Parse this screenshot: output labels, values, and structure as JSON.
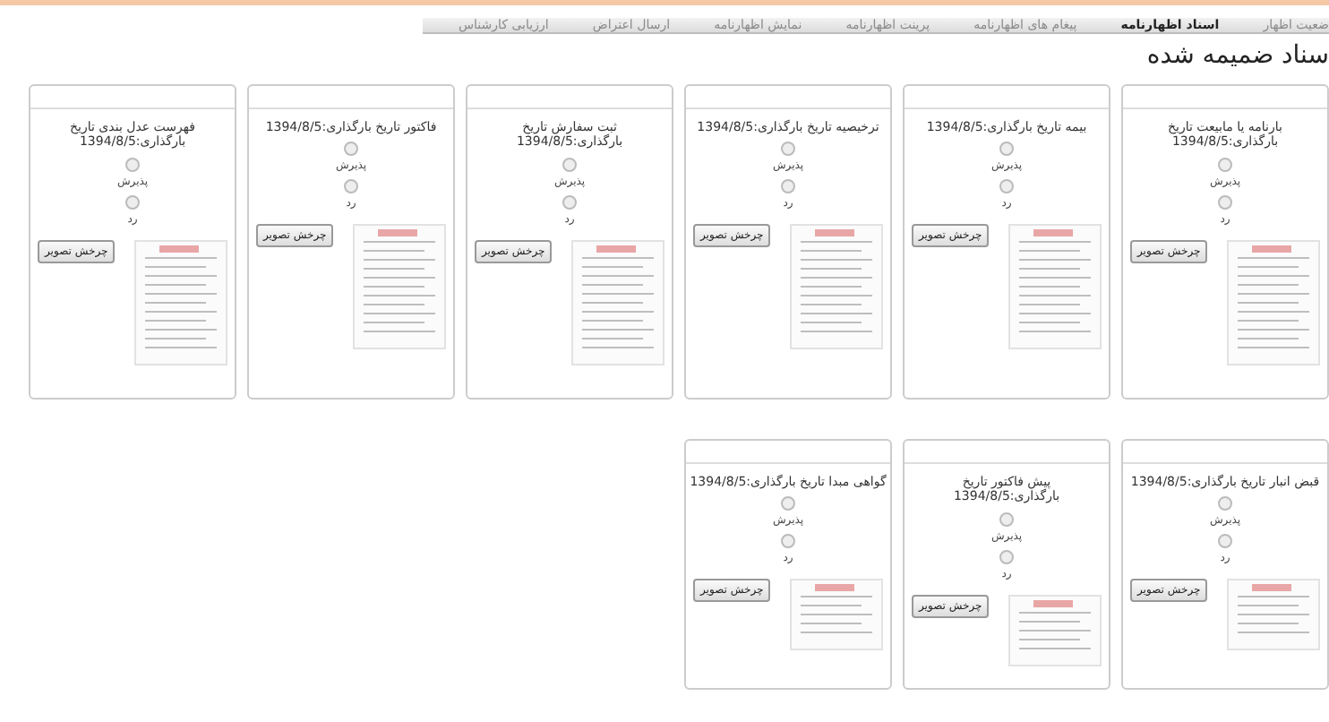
{
  "nav": {
    "tabs": [
      {
        "label": "ضعیت اظهار",
        "selected": false
      },
      {
        "label": "اسناد اظهارنامه",
        "selected": true
      },
      {
        "label": "پیغام های اظهارنامه",
        "selected": false
      },
      {
        "label": "پرینت اظهارنامه",
        "selected": false
      },
      {
        "label": "نمایش اظهارنامه",
        "selected": false
      },
      {
        "label": "ارسال اعتراض",
        "selected": false
      },
      {
        "label": "ارزیابی کارشناس",
        "selected": false
      }
    ]
  },
  "heading": "سناد ضمیمه شده",
  "rows": [
    {
      "cards": [
        {
          "title": "بارنامه یا مابیعت تاریخ بارگذاری:1394/8/5",
          "options": [
            {
              "label": "پذیرش",
              "selected": false
            },
            {
              "label": "رد",
              "selected": false
            }
          ],
          "button": "چرخش تصویر"
        },
        {
          "title": "بیمه تاریخ بارگذاری:1394/8/5",
          "options": [
            {
              "label": "پذیرش",
              "selected": false
            },
            {
              "label": "رد",
              "selected": false
            }
          ],
          "button": "چرخش تصویر"
        },
        {
          "title": "ترخیصیه تاریخ بارگذاری:1394/8/5",
          "options": [
            {
              "label": "پذیرش",
              "selected": false
            },
            {
              "label": "رد",
              "selected": false
            }
          ],
          "button": "چرخش تصویر"
        },
        {
          "title": "ثبت سفارش تاریخ بارگذاری:1394/8/5",
          "options": [
            {
              "label": "پذیرش",
              "selected": false
            },
            {
              "label": "رد",
              "selected": false
            }
          ],
          "button": "چرخش تصویر"
        },
        {
          "title": "فاکتور تاریخ بارگذاری:1394/8/5",
          "options": [
            {
              "label": "پذیرش",
              "selected": false
            },
            {
              "label": "رد",
              "selected": false
            }
          ],
          "button": "چرخش تصویر"
        },
        {
          "title": "فهرست عدل بندی تاریخ بارگذاری:1394/8/5",
          "options": [
            {
              "label": "پذیرش",
              "selected": false
            },
            {
              "label": "رد",
              "selected": false
            }
          ],
          "button": "چرخش تصویر"
        }
      ]
    },
    {
      "cards": [
        {
          "title": "قبض انبار تاریخ بارگذاری:1394/8/5",
          "options": [
            {
              "label": "پذیرش",
              "selected": false
            },
            {
              "label": "رد",
              "selected": false
            }
          ],
          "button": "چرخش تصویر"
        },
        {
          "title": "پیش فاکتور تاریخ بارگذاری:1394/8/5",
          "options": [
            {
              "label": "پذیرش",
              "selected": false
            },
            {
              "label": "رد",
              "selected": false
            }
          ],
          "button": "چرخش تصویر"
        },
        {
          "title": "گواهی مبدا تاریخ بارگذاری:1394/8/5",
          "options": [
            {
              "label": "پذیرش",
              "selected": false
            },
            {
              "label": "رد",
              "selected": false
            }
          ],
          "button": "چرخش تصویر"
        }
      ]
    }
  ]
}
